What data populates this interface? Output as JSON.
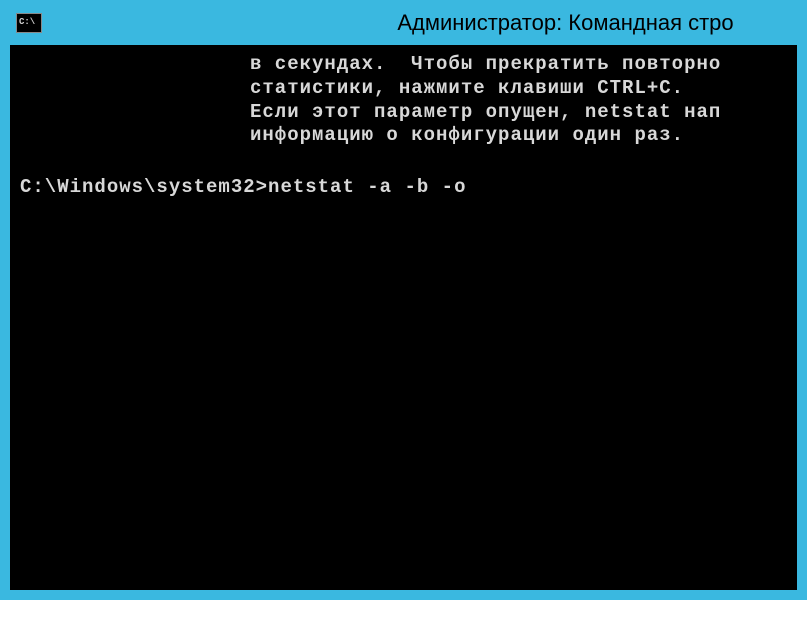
{
  "titlebar": {
    "icon_label": "C:\\",
    "title": "Администратор: Командная стро"
  },
  "console": {
    "help_lines": [
      "в секундах.  Чтобы прекратить повторно",
      "статистики, нажмите клавиши CTRL+C.",
      "Если этот параметр опущен, netstat нап",
      "информацию о конфигурации один раз."
    ],
    "prompt": "C:\\Windows\\system32>",
    "command": "netstat -a -b -o"
  }
}
